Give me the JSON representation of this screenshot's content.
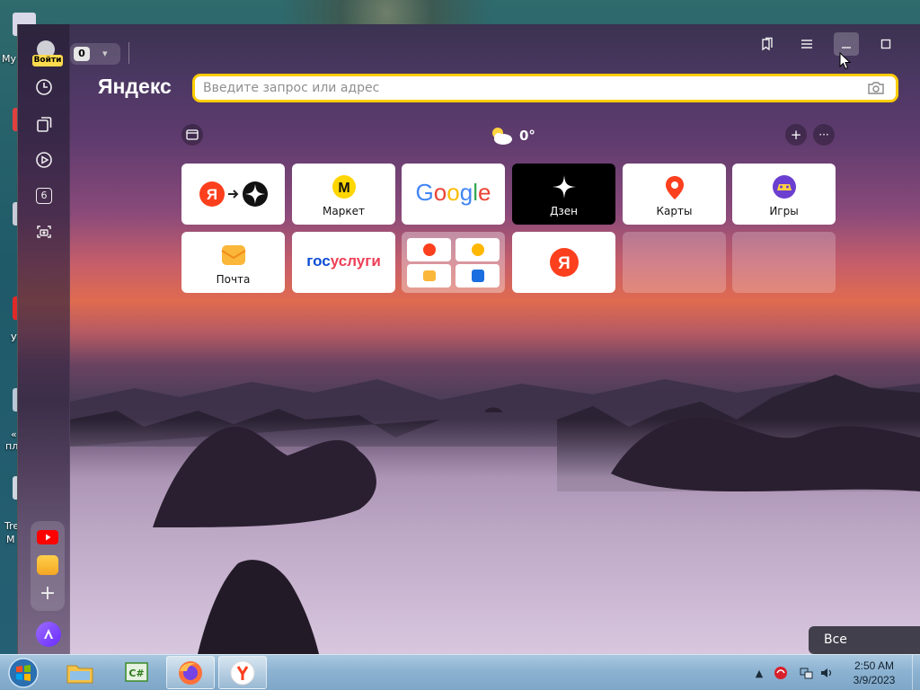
{
  "desktop": {
    "icon_labels": [
      "My",
      "У",
      "«",
      "пл",
      "Tre",
      "M"
    ]
  },
  "browser": {
    "sidebar": {
      "login_label": "Войти",
      "tab_count": "6"
    },
    "topbar": {
      "tab_counter": "0"
    },
    "brand": "Яндекс",
    "search": {
      "placeholder": "Введите запрос или адрес",
      "value": ""
    },
    "weather": {
      "temperature": "0°"
    },
    "tiles": [
      {
        "name": "Яндекс ID",
        "label": ""
      },
      {
        "name": "Маркет",
        "label": "Маркет"
      },
      {
        "name": "Google",
        "label": ""
      },
      {
        "name": "Дзен",
        "label": "Дзен"
      },
      {
        "name": "Карты",
        "label": "Карты"
      },
      {
        "name": "Игры",
        "label": "Игры"
      },
      {
        "name": "Почта",
        "label": "Почта"
      },
      {
        "name": "Госуслуги",
        "label": ""
      },
      {
        "name": "group",
        "label": ""
      },
      {
        "name": "Яндекс",
        "label": ""
      },
      {
        "name": "empty",
        "label": ""
      },
      {
        "name": "empty",
        "label": ""
      }
    ],
    "logos": {
      "google": "Google",
      "gosuslugi_a": "гос",
      "gosuslugi_b": "услуги",
      "ya": "Я",
      "market": "M"
    },
    "all_settings": "Все настройки"
  },
  "taskbar": {
    "time": "2:50 AM",
    "date": "3/9/2023",
    "apps": [
      "explorer",
      "csharp-editor",
      "firefox",
      "yandex-browser"
    ]
  },
  "colors": {
    "accent": "#ffcc00",
    "yandex_red": "#fc3f1d",
    "taskbar": "#8db3d2"
  }
}
